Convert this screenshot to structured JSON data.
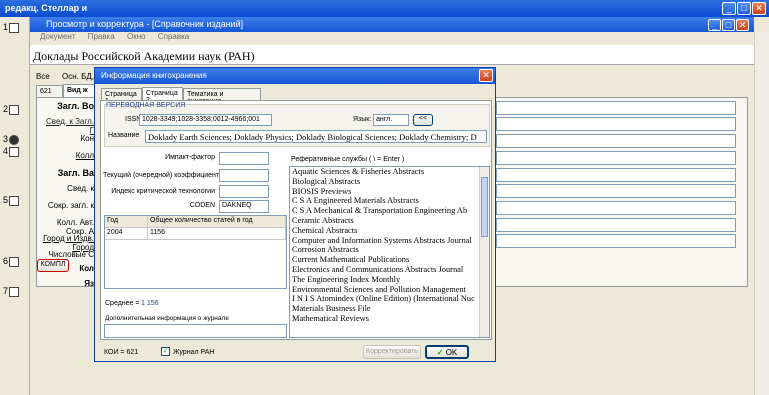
{
  "outer_window": {
    "title": "редакц. Стеллар и",
    "min": "_",
    "max": "□",
    "close": "✕"
  },
  "row_numbers": [
    "1",
    "2",
    "3",
    "4",
    "5",
    "6",
    "7"
  ],
  "inner_window": {
    "title": "Просмотр и корректура - [Справочник изданий]",
    "menu": [
      "Документ",
      "Правка",
      "Окно",
      "Справка"
    ],
    "journal_title": "Доклады Российской Академии наук (РАН)"
  },
  "background_form": {
    "row1": [
      "Все",
      "Осн. БД, не"
    ],
    "tab_stub": [
      "621",
      "Вид ж"
    ],
    "labels": [
      "Загл. Во",
      "Свед. к Загл. Г",
      "Кон",
      "Колл",
      "Загл. Ва",
      "Свед. к",
      "Сокр. загл. к",
      "Колл. Авт. Сокр. А",
      "Город и Издв. Город",
      "Числовые С",
      "Кол",
      "Яз"
    ],
    "komp_button": "КОМПЛ"
  },
  "dialog": {
    "title": "Информация книгохранения",
    "close": "✕",
    "tabs": [
      "Страница 1",
      "Страница 2",
      "Тематика и аннотация"
    ],
    "section_label": "ПЕРЕВОДНАЯ ВЕРСИЯ",
    "issn_label": "ISSN",
    "issn_value": "1028-3349;1028-3358;0012-4966;001",
    "lang_label": "Язык:",
    "lang_value": "англ.",
    "lang_button": "<<",
    "name_label": "Название",
    "name_value": "Doklady Earth Sciences; Doklady Physics; Doklady Biological Sciences; Doklady Chemistry; D",
    "impact_label": "Импакт-фактор",
    "impact_value": "",
    "current_coef_label": "Текущий (очередной) коэффициент",
    "current_coef_value": "",
    "critical_tech_label": "Индекс критической технологии",
    "critical_tech_value": "",
    "coden_label": "CODEN",
    "coden_value": "DAKNEQ",
    "table_headers": [
      "Год",
      "Общее количество статей в год"
    ],
    "table_rows": [
      [
        "2004",
        "1156"
      ]
    ],
    "average_label": "Среднее =",
    "average_value": "1 156",
    "extra_info_label": "Дополнительная информация о журнале",
    "extra_info_value": "",
    "services_label": "Реферативные службы ( \\ = Enter )",
    "services": [
      "Aquatic Sciences & Fisheries Abstracts",
      "Biological Abstracts",
      "BIOSIS Previews",
      "C S A Engineered Materials Abstracts",
      "C S A Mechanical & Transportation Engineering Ab",
      "Ceramic Abstracts",
      "Chemical Abstracts",
      "Computer and Information Systems Abstracts Journal",
      "Corrosion Abstracts",
      "Current Mathematical Publications",
      "Electronics and Communications Abstracts Journal",
      "The Engineering Index Monthly",
      "Environmental Sciences and Pollution Management",
      "I N I S Atomindex (Online Edition) (International Nuc",
      "Materials Business File",
      "Mathematical Reviews"
    ],
    "koi_label": "КОИ = 621",
    "checkbox_label": "Журнал РАН",
    "checkbox_mark": "✓",
    "corr_button": "Корректировать",
    "ok_button": "OK",
    "ok_icon": "✓"
  }
}
